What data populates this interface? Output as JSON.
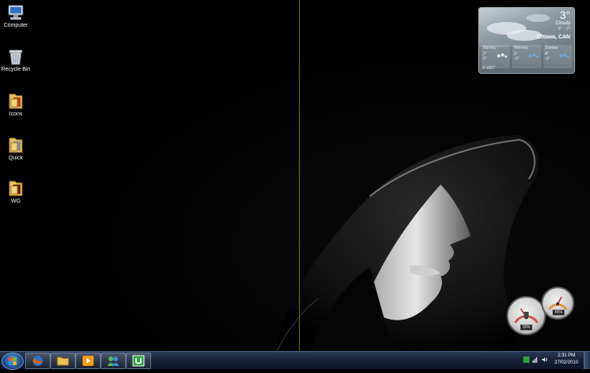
{
  "desktop": {
    "icons": [
      {
        "label": "Computer",
        "icon": "computer-icon"
      },
      {
        "label": "Recycle Bin",
        "icon": "recycle-bin-icon"
      },
      {
        "label": "Icons",
        "icon": "folder-icon"
      },
      {
        "label": "Quick",
        "icon": "folder-icon"
      },
      {
        "label": "WG",
        "icon": "folder-icon"
      }
    ]
  },
  "weather_gadget": {
    "temperature": "3°",
    "condition": "Cloudy",
    "hi_lo": "3° - -2°",
    "city": "Ottawa, CAN",
    "forecast": [
      {
        "day": "Sunday",
        "temps": "2°\n0°"
      },
      {
        "day": "Monday",
        "temps": "3°\n-3°"
      },
      {
        "day": "Sunday",
        "temps": "4°\n-3°"
      }
    ],
    "credit": "© WDT"
  },
  "meter_gadget": {
    "cpu_readout": "33%",
    "ram_readout": "45%"
  },
  "taskbar": {
    "buttons": [
      "start-button",
      "firefox-button",
      "explorer-button",
      "media-player-button",
      "messenger-button",
      "utorrent-button"
    ],
    "clock_time": "2:31 PM",
    "clock_date": "27/02/2010",
    "colors": {
      "accent": "#1f4f92",
      "bar": "#17223a"
    }
  }
}
